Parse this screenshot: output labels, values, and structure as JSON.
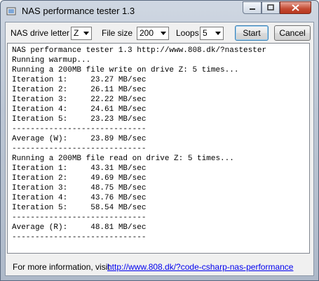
{
  "window": {
    "title": "NAS performance tester 1.3"
  },
  "controls": {
    "drive_label": "NAS drive letter",
    "drive_value": "Z",
    "filesize_label": "File size",
    "filesize_value": "200",
    "loops_label": "Loops",
    "loops_value": "5",
    "start_label": "Start",
    "cancel_label": "Cancel"
  },
  "output": {
    "lines": [
      "NAS performance tester 1.3 http://www.808.dk/?nastester",
      "Running warmup...",
      "Running a 200MB file write on drive Z: 5 times...",
      "Iteration 1:     23.27 MB/sec",
      "Iteration 2:     26.11 MB/sec",
      "Iteration 3:     22.22 MB/sec",
      "Iteration 4:     24.61 MB/sec",
      "Iteration 5:     23.23 MB/sec",
      "-----------------------------",
      "Average (W):     23.89 MB/sec",
      "-----------------------------",
      "Running a 200MB file read on drive Z: 5 times...",
      "Iteration 1:     43.31 MB/sec",
      "Iteration 2:     49.69 MB/sec",
      "Iteration 3:     48.75 MB/sec",
      "Iteration 4:     43.76 MB/sec",
      "Iteration 5:     58.54 MB/sec",
      "-----------------------------",
      "Average (R):     48.81 MB/sec",
      "-----------------------------"
    ]
  },
  "footer": {
    "text": "For more information, visit",
    "link": "http://www.808.dk/?code-csharp-nas-performance"
  }
}
